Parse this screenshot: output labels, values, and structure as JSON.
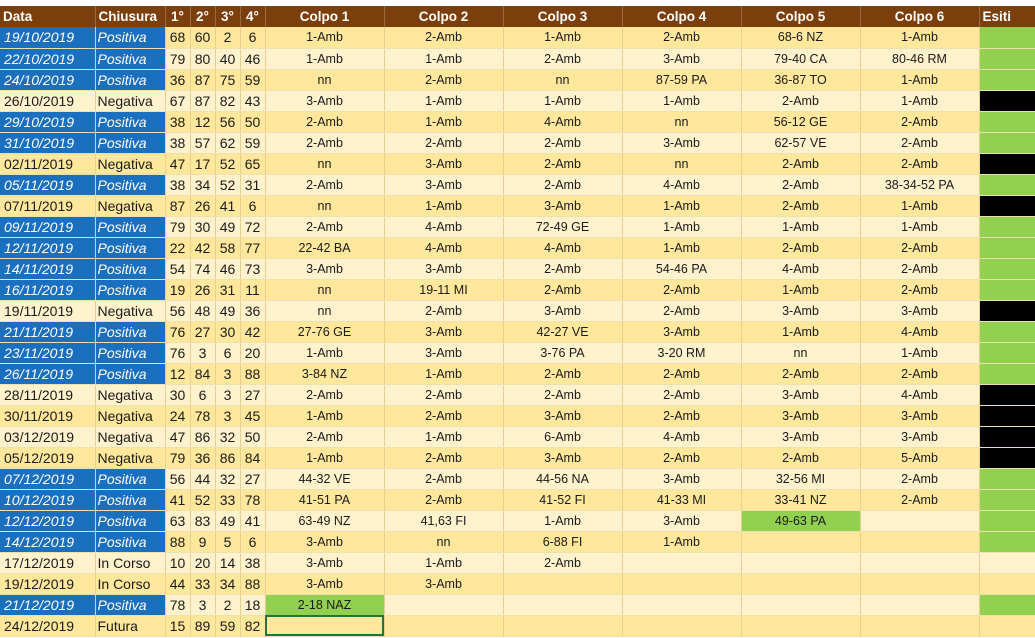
{
  "headers": [
    "Data",
    "Chiusura",
    "1°",
    "2°",
    "3°",
    "4°",
    "Colpo 1",
    "Colpo 2",
    "Colpo 3",
    "Colpo 4",
    "Colpo 5",
    "Colpo 6",
    "Esiti"
  ],
  "rows": [
    {
      "data": "19/10/2019",
      "chiusura": "Positiva",
      "n": [
        "68",
        "60",
        "2",
        "6"
      ],
      "colpi": [
        "1-Amb",
        "2-Amb",
        "1-Amb",
        "2-Amb",
        "68-6 NZ",
        "1-Amb"
      ],
      "hl": -1,
      "esito": "green"
    },
    {
      "data": "22/10/2019",
      "chiusura": "Positiva",
      "n": [
        "79",
        "80",
        "40",
        "46"
      ],
      "colpi": [
        "1-Amb",
        "1-Amb",
        "2-Amb",
        "3-Amb",
        "79-40 CA",
        "80-46 RM"
      ],
      "hl": -1,
      "esito": "green"
    },
    {
      "data": "24/10/2019",
      "chiusura": "Positiva",
      "n": [
        "36",
        "87",
        "75",
        "59"
      ],
      "colpi": [
        "nn",
        "2-Amb",
        "nn",
        "87-59 PA",
        "36-87 TO",
        "1-Amb"
      ],
      "hl": -1,
      "esito": "green"
    },
    {
      "data": "26/10/2019",
      "chiusura": "Negativa",
      "n": [
        "67",
        "87",
        "82",
        "43"
      ],
      "colpi": [
        "3-Amb",
        "1-Amb",
        "1-Amb",
        "1-Amb",
        "2-Amb",
        "1-Amb"
      ],
      "hl": -1,
      "esito": "black"
    },
    {
      "data": "29/10/2019",
      "chiusura": "Positiva",
      "n": [
        "38",
        "12",
        "56",
        "50"
      ],
      "colpi": [
        "2-Amb",
        "1-Amb",
        "4-Amb",
        "nn",
        "56-12 GE",
        "2-Amb"
      ],
      "hl": -1,
      "esito": "green"
    },
    {
      "data": "31/10/2019",
      "chiusura": "Positiva",
      "n": [
        "38",
        "57",
        "62",
        "59"
      ],
      "colpi": [
        "2-Amb",
        "2-Amb",
        "2-Amb",
        "3-Amb",
        "62-57 VE",
        "2-Amb"
      ],
      "hl": -1,
      "esito": "green"
    },
    {
      "data": "02/11/2019",
      "chiusura": "Negativa",
      "n": [
        "47",
        "17",
        "52",
        "65"
      ],
      "colpi": [
        "nn",
        "3-Amb",
        "2-Amb",
        "nn",
        "2-Amb",
        "2-Amb"
      ],
      "hl": -1,
      "esito": "black"
    },
    {
      "data": "05/11/2019",
      "chiusura": "Positiva",
      "n": [
        "38",
        "34",
        "52",
        "31"
      ],
      "colpi": [
        "2-Amb",
        "3-Amb",
        "2-Amb",
        "4-Amb",
        "2-Amb",
        "38-34-52 PA"
      ],
      "hl": -1,
      "esito": "green"
    },
    {
      "data": "07/11/2019",
      "chiusura": "Negativa",
      "n": [
        "87",
        "26",
        "41",
        "6"
      ],
      "colpi": [
        "nn",
        "1-Amb",
        "3-Amb",
        "1-Amb",
        "2-Amb",
        "1-Amb"
      ],
      "hl": -1,
      "esito": "black"
    },
    {
      "data": "09/11/2019",
      "chiusura": "Positiva",
      "n": [
        "79",
        "30",
        "49",
        "72"
      ],
      "colpi": [
        "2-Amb",
        "4-Amb",
        "72-49 GE",
        "1-Amb",
        "1-Amb",
        "1-Amb"
      ],
      "hl": -1,
      "esito": "green"
    },
    {
      "data": "12/11/2019",
      "chiusura": "Positiva",
      "n": [
        "22",
        "42",
        "58",
        "77"
      ],
      "colpi": [
        "22-42 BA",
        "4-Amb",
        "4-Amb",
        "1-Amb",
        "2-Amb",
        "2-Amb"
      ],
      "hl": -1,
      "esito": "green"
    },
    {
      "data": "14/11/2019",
      "chiusura": "Positiva",
      "n": [
        "54",
        "74",
        "46",
        "73"
      ],
      "colpi": [
        "3-Amb",
        "3-Amb",
        "2-Amb",
        "54-46 PA",
        "4-Amb",
        "2-Amb"
      ],
      "hl": -1,
      "esito": "green"
    },
    {
      "data": "16/11/2019",
      "chiusura": "Positiva",
      "n": [
        "19",
        "26",
        "31",
        "11"
      ],
      "colpi": [
        "nn",
        "19-11 MI",
        "2-Amb",
        "2-Amb",
        "1-Amb",
        "2-Amb"
      ],
      "hl": -1,
      "esito": "green"
    },
    {
      "data": "19/11/2019",
      "chiusura": "Negativa",
      "n": [
        "56",
        "48",
        "49",
        "36"
      ],
      "colpi": [
        "nn",
        "2-Amb",
        "3-Amb",
        "2-Amb",
        "3-Amb",
        "3-Amb"
      ],
      "hl": -1,
      "esito": "black"
    },
    {
      "data": "21/11/2019",
      "chiusura": "Positiva",
      "n": [
        "76",
        "27",
        "30",
        "42"
      ],
      "colpi": [
        "27-76 GE",
        "3-Amb",
        "42-27 VE",
        "3-Amb",
        "1-Amb",
        "4-Amb"
      ],
      "hl": -1,
      "esito": "green"
    },
    {
      "data": "23/11/2019",
      "chiusura": "Positiva",
      "n": [
        "76",
        "3",
        "6",
        "20"
      ],
      "colpi": [
        "1-Amb",
        "3-Amb",
        "3-76 PA",
        "3-20 RM",
        "nn",
        "1-Amb"
      ],
      "hl": -1,
      "esito": "green"
    },
    {
      "data": "26/11/2019",
      "chiusura": "Positiva",
      "n": [
        "12",
        "84",
        "3",
        "88"
      ],
      "colpi": [
        "3-84 NZ",
        "1-Amb",
        "2-Amb",
        "2-Amb",
        "2-Amb",
        "2-Amb"
      ],
      "hl": -1,
      "esito": "green"
    },
    {
      "data": "28/11/2019",
      "chiusura": "Negativa",
      "n": [
        "30",
        "6",
        "3",
        "27"
      ],
      "colpi": [
        "2-Amb",
        "2-Amb",
        "2-Amb",
        "2-Amb",
        "3-Amb",
        "4-Amb"
      ],
      "hl": -1,
      "esito": "black"
    },
    {
      "data": "30/11/2019",
      "chiusura": "Negativa",
      "n": [
        "24",
        "78",
        "3",
        "45"
      ],
      "colpi": [
        "1-Amb",
        "2-Amb",
        "3-Amb",
        "2-Amb",
        "3-Amb",
        "3-Amb"
      ],
      "hl": -1,
      "esito": "black"
    },
    {
      "data": "03/12/2019",
      "chiusura": "Negativa",
      "n": [
        "47",
        "86",
        "32",
        "50"
      ],
      "colpi": [
        "2-Amb",
        "1-Amb",
        "6-Amb",
        "4-Amb",
        "3-Amb",
        "3-Amb"
      ],
      "hl": -1,
      "esito": "black"
    },
    {
      "data": "05/12/2019",
      "chiusura": "Negativa",
      "n": [
        "79",
        "36",
        "86",
        "84"
      ],
      "colpi": [
        "1-Amb",
        "2-Amb",
        "3-Amb",
        "2-Amb",
        "2-Amb",
        "5-Amb"
      ],
      "hl": -1,
      "esito": "black"
    },
    {
      "data": "07/12/2019",
      "chiusura": "Positiva",
      "n": [
        "56",
        "44",
        "32",
        "27"
      ],
      "colpi": [
        "44-32 VE",
        "2-Amb",
        "44-56 NA",
        "3-Amb",
        "32-56 MI",
        "2-Amb"
      ],
      "hl": -1,
      "esito": "green"
    },
    {
      "data": "10/12/2019",
      "chiusura": "Positiva",
      "n": [
        "41",
        "52",
        "33",
        "78"
      ],
      "colpi": [
        "41-51 PA",
        "2-Amb",
        "41-52 FI",
        "41-33 MI",
        "33-41 NZ",
        "2-Amb"
      ],
      "hl": -1,
      "esito": "green"
    },
    {
      "data": "12/12/2019",
      "chiusura": "Positiva",
      "n": [
        "63",
        "83",
        "49",
        "41"
      ],
      "colpi": [
        "63-49 NZ",
        "41,63 FI",
        "1-Amb",
        "3-Amb",
        "49-63 PA",
        ""
      ],
      "hl": 4,
      "esito": "green"
    },
    {
      "data": "14/12/2019",
      "chiusura": "Positiva",
      "n": [
        "88",
        "9",
        "5",
        "6"
      ],
      "colpi": [
        "3-Amb",
        "nn",
        "6-88 FI",
        "1-Amb",
        "",
        ""
      ],
      "hl": -1,
      "esito": "green"
    },
    {
      "data": "17/12/2019",
      "chiusura": "In Corso",
      "n": [
        "10",
        "20",
        "14",
        "38"
      ],
      "colpi": [
        "3-Amb",
        "1-Amb",
        "2-Amb",
        "",
        "",
        ""
      ],
      "hl": -1,
      "esito": "none"
    },
    {
      "data": "19/12/2019",
      "chiusura": "In Corso",
      "n": [
        "44",
        "33",
        "34",
        "88"
      ],
      "colpi": [
        "3-Amb",
        "3-Amb",
        "",
        "",
        "",
        ""
      ],
      "hl": -1,
      "esito": "none"
    },
    {
      "data": "21/12/2019",
      "chiusura": "Positiva",
      "n": [
        "78",
        "3",
        "2",
        "18"
      ],
      "colpi": [
        "2-18 NAZ",
        "",
        "",
        "",
        "",
        ""
      ],
      "hl": 0,
      "esito": "green"
    },
    {
      "data": "24/12/2019",
      "chiusura": "Futura",
      "n": [
        "15",
        "89",
        "59",
        "82"
      ],
      "colpi": [
        "",
        "",
        "",
        "",
        "",
        ""
      ],
      "hl": -1,
      "esito": "none",
      "selected": 0
    }
  ],
  "colors": {
    "header": "#7b3f0e",
    "positive": "#1b6fbf",
    "green": "#92d050",
    "rowA": "#ffe79c",
    "rowB": "#fff2cc"
  }
}
